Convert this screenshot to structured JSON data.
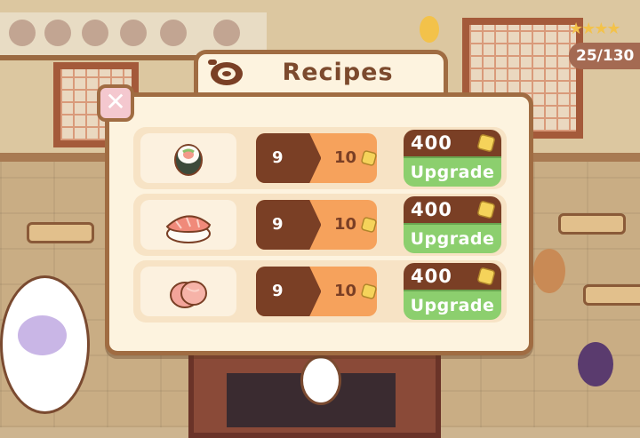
{
  "hud": {
    "stars": "★★★★",
    "count": "25/130"
  },
  "dialog": {
    "title": "Recipes",
    "header_icon": "recipe-icon",
    "close_icon": "close-icon",
    "close_label": "✕"
  },
  "colors": {
    "brown": "#7a3f25",
    "orange": "#f6a25c",
    "green": "#8ccf6e",
    "cream": "#fdf3df",
    "pink": "#f4c8cf"
  },
  "recipes": [
    {
      "dish_icon": "roll-sushi-icon",
      "level": "9",
      "max_level": "10",
      "level_progress": 0.9,
      "cost": "400",
      "button_label": "Upgrade"
    },
    {
      "dish_icon": "salmon-nigiri-icon",
      "level": "9",
      "max_level": "10",
      "level_progress": 0.9,
      "cost": "400",
      "button_label": "Upgrade"
    },
    {
      "dish_icon": "sashimi-icon",
      "level": "9",
      "max_level": "10",
      "level_progress": 0.9,
      "cost": "400",
      "button_label": "Upgrade"
    }
  ]
}
